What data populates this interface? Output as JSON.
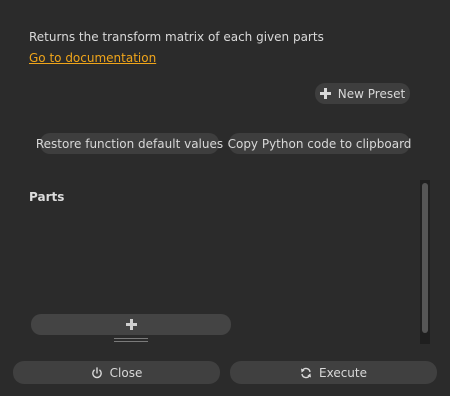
{
  "description": "Returns the transform matrix of each given parts",
  "doc_link": "Go to documentation",
  "presets": {
    "new_preset_label": "New Preset",
    "icon": "plus-icon"
  },
  "actions": {
    "restore_label": "Restore function default values",
    "copy_label": "Copy Python code to clipboard"
  },
  "parts": {
    "label": "Parts",
    "add_icon": "plus-icon"
  },
  "footer": {
    "close_label": "Close",
    "close_icon": "power-icon",
    "execute_label": "Execute",
    "execute_icon": "refresh-icon"
  },
  "colors": {
    "background": "#2b2b2b",
    "button": "#3e3e3e",
    "link": "#f0a51a",
    "text": "#d9d9d9"
  }
}
